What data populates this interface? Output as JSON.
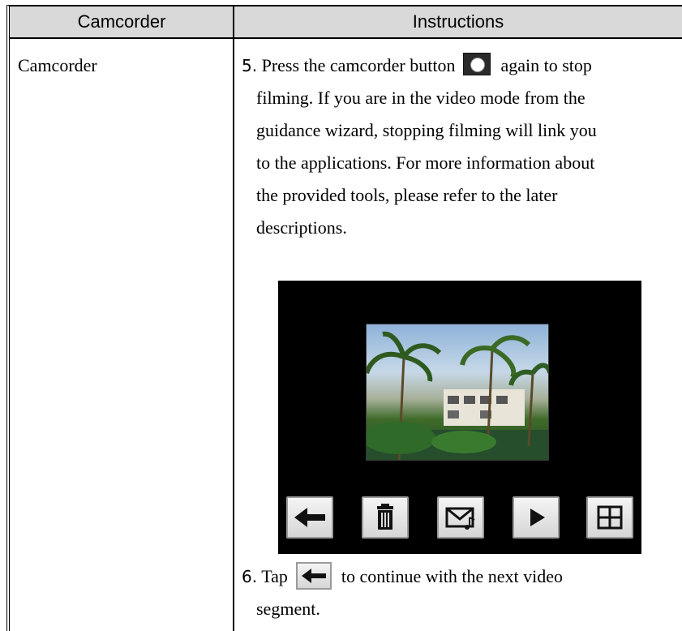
{
  "table": {
    "header": {
      "col1": "Camcorder",
      "col2": "Instructions"
    },
    "row": {
      "category": "Camcorder"
    }
  },
  "steps": {
    "step5": {
      "number": "5.",
      "line1_before_icon": "Press the camcorder button",
      "line1_after_icon": "again to stop",
      "line2": "filming. If you are in the video mode from the",
      "line3": "guidance wizard, stopping filming will link you",
      "line4": "to the applications. For more information about",
      "line5": "the provided tools, please refer to the later",
      "line6": "descriptions."
    },
    "step6": {
      "number": "6.",
      "line1_before_icon": "Tap",
      "line1_after_icon": "to continue with the next video",
      "line2": "segment."
    }
  },
  "icons": {
    "inline_camera": "camera-icon",
    "back": "back-arrow-icon",
    "delete": "trash-icon",
    "send": "envelope-icon",
    "play": "play-icon",
    "grid": "grid-icon"
  },
  "colors": {
    "header_bg": "#d9d9d9",
    "screen_bg": "#000000",
    "button_face": "#e6e6e6"
  }
}
